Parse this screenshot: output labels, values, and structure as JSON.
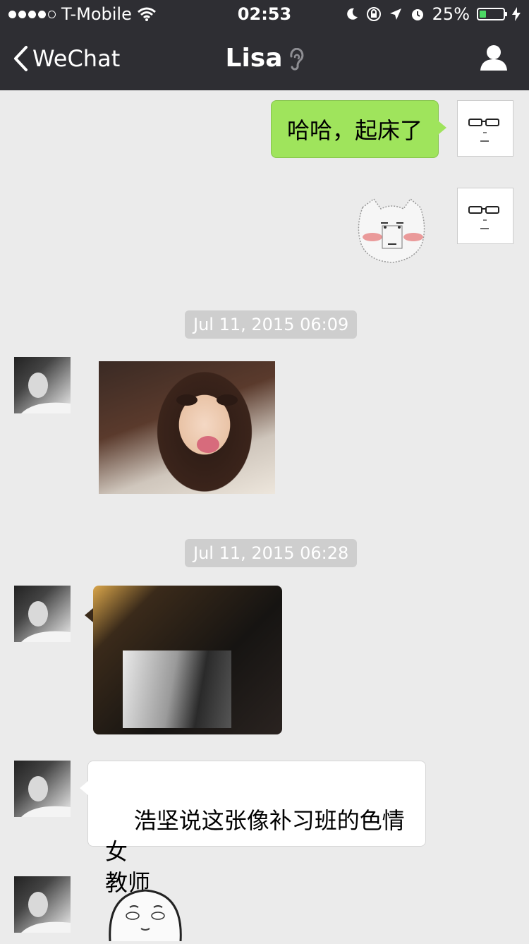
{
  "status_bar": {
    "carrier": "T-Mobile",
    "time": "02:53",
    "battery_percent": "25%",
    "battery_level": 0.25
  },
  "nav": {
    "back_label": "WeChat",
    "title": "Lisa",
    "icons": [
      "chevron-left-icon",
      "ear-icon",
      "contact-icon"
    ]
  },
  "messages": [
    {
      "sender": "me",
      "type": "text",
      "text": "哈哈，起床了"
    },
    {
      "sender": "me",
      "type": "sticker",
      "sticker": "blushing-cat-face-sticker"
    },
    {
      "type": "timestamp",
      "text": "Jul 11, 2015 06:09"
    },
    {
      "sender": "Lisa",
      "type": "image",
      "image": "little-girl-kissing-face-photo"
    },
    {
      "type": "timestamp",
      "text": "Jul 11, 2015 06:28"
    },
    {
      "sender": "Lisa",
      "type": "image",
      "image": "camera-lcd-screen-photo"
    },
    {
      "sender": "Lisa",
      "type": "text",
      "text": "浩坚说这张像补习班的色情女\n教师"
    },
    {
      "sender": "Lisa",
      "type": "sticker",
      "sticker": "rolling-eyes-face-sticker"
    }
  ],
  "colors": {
    "nav_bg": "#2e2e33",
    "chat_bg": "#ebebeb",
    "my_bubble": "#9fe45c",
    "their_bubble": "#ffffff",
    "timestamp_chip": "#cecece"
  }
}
